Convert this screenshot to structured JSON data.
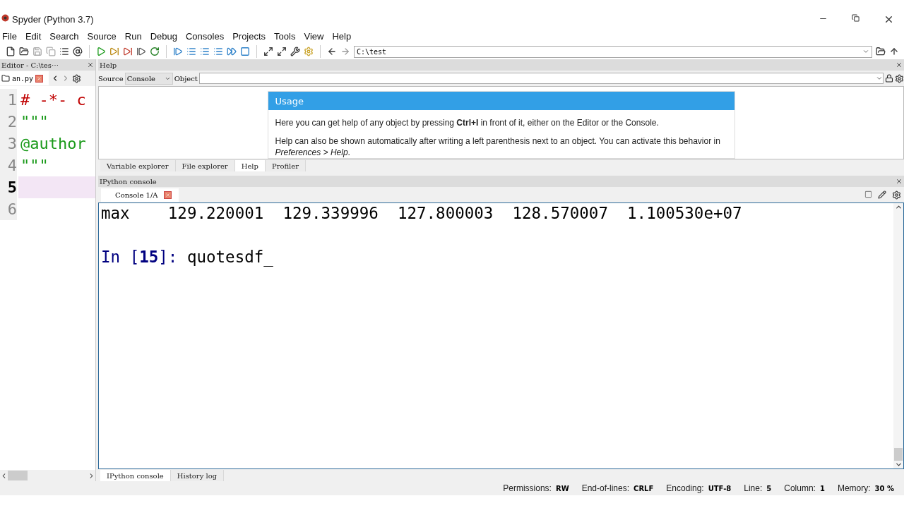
{
  "window": {
    "title": "Spyder (Python 3.7)"
  },
  "menu": [
    "File",
    "Edit",
    "Search",
    "Source",
    "Run",
    "Debug",
    "Consoles",
    "Projects",
    "Tools",
    "View",
    "Help"
  ],
  "path_field": {
    "value": "C:\\test"
  },
  "editor": {
    "title": "Editor - C:\\tes⋯",
    "tab": "an.py",
    "lines": [
      {
        "number": "1",
        "text": "# -*- c",
        "kind": "comment",
        "current": false
      },
      {
        "number": "2",
        "text": "\"\"\"",
        "kind": "string",
        "current": false
      },
      {
        "number": "3",
        "text": "@author",
        "kind": "string",
        "current": false
      },
      {
        "number": "4",
        "text": "\"\"\"",
        "kind": "string",
        "current": false
      },
      {
        "number": "5",
        "current": true
      },
      {
        "number": "6",
        "current": false
      }
    ]
  },
  "help": {
    "title": "Help",
    "source_label": "Source",
    "source_value": "Console",
    "object_label": "Object",
    "usage_title": "Usage",
    "paragraphs": [
      "Here you can get help of any object by pressing **Ctrl+I** in front of it, either on the Editor or the Console.",
      "Help can also be shown automatically after writing a left parenthesis next to an object. You can activate this behavior in *Preferences > Help*."
    ],
    "tabs": [
      {
        "label": "Variable explorer",
        "selected": false
      },
      {
        "label": "File explorer",
        "selected": false
      },
      {
        "label": "Help",
        "selected": true
      },
      {
        "label": "Profiler",
        "selected": false
      }
    ]
  },
  "console": {
    "title": "IPython console",
    "tab": "Console 1/A",
    "output": "max    129.220001  129.339996  127.800003  128.570007  1.100530e+07",
    "prompt_start": "In [",
    "prompt_number": "15",
    "prompt_end": "]: ",
    "input": "quotesdf_",
    "tabs": [
      {
        "label": "IPython console",
        "selected": true
      },
      {
        "label": "History log",
        "selected": false
      }
    ]
  },
  "status_bar": [
    {
      "label": "Permissions:",
      "value": "RW"
    },
    {
      "label": "End-of-lines:",
      "value": "CRLF"
    },
    {
      "label": "Encoding:",
      "value": "UTF-8"
    },
    {
      "label": "Line:",
      "value": "5"
    },
    {
      "label": "Column:",
      "value": "1"
    },
    {
      "label": "Memory:",
      "value": "30 %"
    }
  ]
}
